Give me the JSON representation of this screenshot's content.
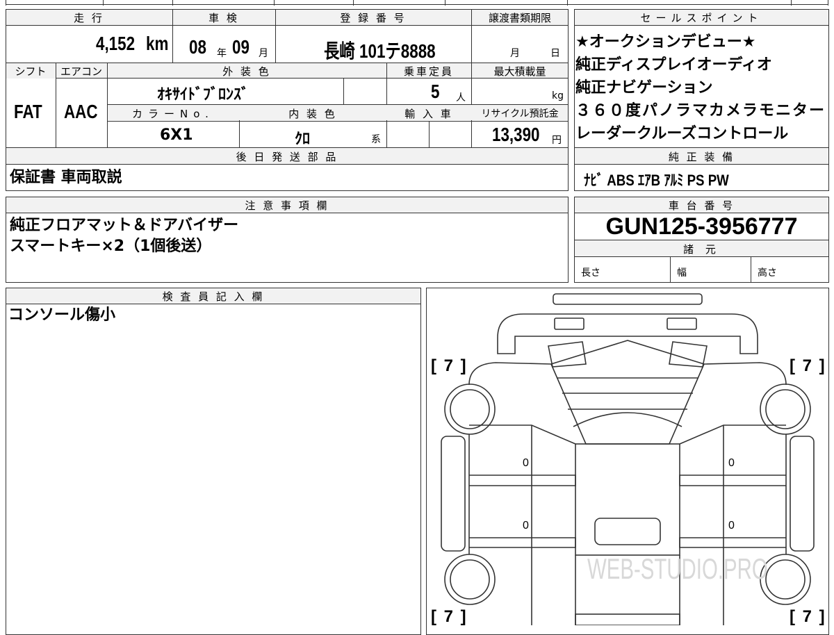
{
  "top_fields": {
    "mileage": {
      "label": "走 行",
      "value": "4,152",
      "unit": "km"
    },
    "inspection": {
      "label": "車 検",
      "year": "08",
      "year_unit": "年",
      "month": "09",
      "month_unit": "月"
    },
    "registration": {
      "label": "登 録 番 号",
      "value": "長崎 101テ8888"
    },
    "transfer_deadline": {
      "label": "譲渡書類期限",
      "month_unit": "月",
      "day_unit": "日"
    }
  },
  "sales_points": {
    "header": "セールスポイント",
    "items": [
      "★オークションデビュー★",
      "純正ディスプレイオーディオ",
      "純正ナビゲーション",
      "３６０度パノラマカメラモニター",
      "レーダークルーズコントロール"
    ]
  },
  "vehicle_row": {
    "shift": {
      "label": "シフト",
      "value": "FAT"
    },
    "aircon": {
      "label": "エアコン",
      "value": "AAC"
    },
    "exterior_color": {
      "label": "外 装 色",
      "value": "ｵｷｻｲﾄﾞﾌﾞﾛﾝｽﾞ"
    },
    "capacity": {
      "label": "乗車定員",
      "value": "5",
      "unit": "人"
    },
    "max_load": {
      "label": "最大積載量",
      "unit": "kg"
    },
    "color_no": {
      "label": "カラーNo.",
      "value": "6X1"
    },
    "interior_color": {
      "label": "内 装 色",
      "value": "ｸﾛ",
      "suffix": "系"
    },
    "import": {
      "label": "輸 入 車"
    },
    "recycle_fee": {
      "label": "リサイクル預託金",
      "value": "13,390",
      "unit": "円"
    }
  },
  "later_shipping": {
    "header": "後 日 発 送 部 品",
    "value": "保証書 車両取説"
  },
  "standard_equipment": {
    "header": "純 正 装 備",
    "value": "ﾅﾋﾞ ABS ｴｱB ｱﾙﾐ PS PW"
  },
  "notes": {
    "header": "注 意 事 項 欄",
    "lines": [
      "純正フロアマット＆ドアバイザー",
      "スマートキー×2（1個後送）"
    ]
  },
  "chassis": {
    "header": "車 台 番 号",
    "value": "GUN125-3956777"
  },
  "specs": {
    "header": "諸 元",
    "length_label": "長さ",
    "width_label": "幅",
    "height_label": "高さ"
  },
  "inspector": {
    "header": "検 査 員 記 入 欄",
    "value": "コンソール傷小"
  },
  "diagram": {
    "tire_marks": [
      "[ 7 ]",
      "[ 7 ]",
      "[ 7 ]",
      "[ 7 ]"
    ],
    "panel_marks": [
      "0",
      "0",
      "0",
      "0"
    ],
    "watermark": "WEB-STUDIO.PRO"
  },
  "colors": {
    "header_bg": "#f2f2f2",
    "border": "#333333"
  }
}
